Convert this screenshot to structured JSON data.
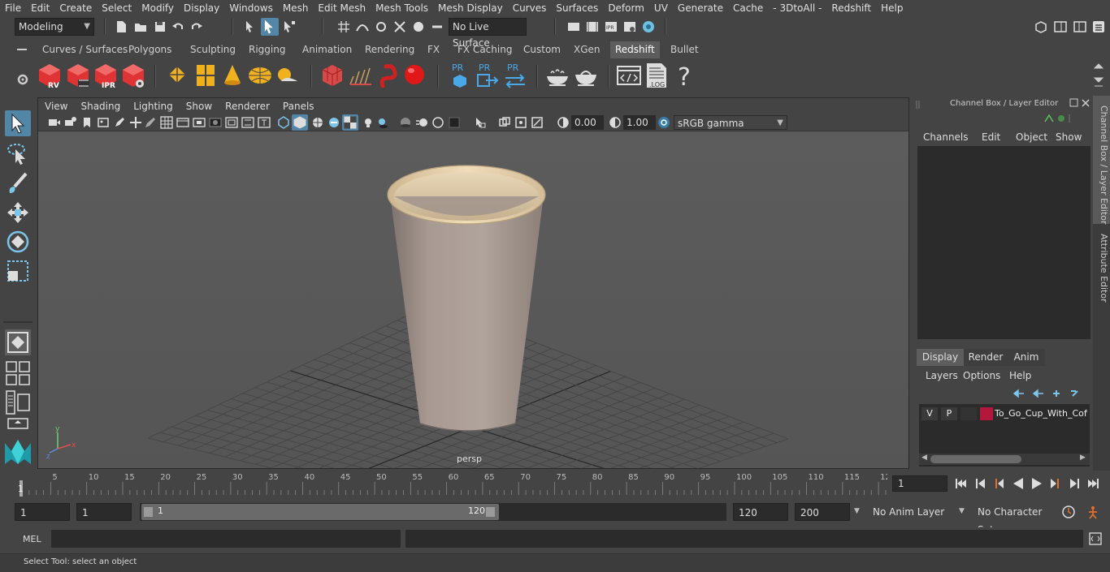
{
  "menubar": {
    "items": [
      "File",
      "Edit",
      "Create",
      "Select",
      "Modify",
      "Display",
      "Windows",
      "Mesh",
      "Edit Mesh",
      "Mesh Tools",
      "Mesh Display",
      "Curves",
      "Surfaces",
      "Deform",
      "UV",
      "Generate",
      "Cache",
      "- 3DtoAll -",
      "Redshift",
      "Help"
    ]
  },
  "statusline": {
    "mode": "Modeling",
    "live_surface": "No Live Surface"
  },
  "shelf": {
    "tabs": [
      "Curves / Surfaces",
      "Polygons",
      "Sculpting",
      "Rigging",
      "Animation",
      "Rendering",
      "FX",
      "FX Caching",
      "Custom",
      "XGen",
      "Redshift",
      "Bullet"
    ],
    "active_tab": "Redshift",
    "icon_labels": {
      "rv": "RV",
      "ipr": "IPR",
      "pr1": "PR",
      "pr2": "PR",
      "pr3": "PR",
      "log": ".LOG",
      "help": "?"
    }
  },
  "viewport": {
    "menu": [
      "View",
      "Shading",
      "Lighting",
      "Show",
      "Renderer",
      "Panels"
    ],
    "exposure": "0.00",
    "gamma": "1.00",
    "color_space": "sRGB gamma",
    "camera_label": "persp",
    "axis_x": "x",
    "axis_y": "y",
    "axis_z": "z"
  },
  "right_panel": {
    "title": "Channel Box / Layer Editor",
    "channel_menu": [
      "Channels",
      "Edit",
      "Object",
      "Show"
    ],
    "layer_tabs": [
      "Display",
      "Render",
      "Anim"
    ],
    "layer_menu": [
      "Layers",
      "Options",
      "Help"
    ],
    "layer": {
      "v": "V",
      "p": "P",
      "name": "To_Go_Cup_With_Coff",
      "color": "#b3173a"
    }
  },
  "side_tabs": [
    "Channel Box / Layer Editor",
    "Attribute Editor"
  ],
  "timeline": {
    "ticks": [
      "5",
      "10",
      "15",
      "20",
      "25",
      "30",
      "35",
      "40",
      "45",
      "50",
      "55",
      "60",
      "65",
      "70",
      "75",
      "80",
      "85",
      "90",
      "95",
      "100",
      "105",
      "110",
      "115",
      "12"
    ],
    "start_marker": "1",
    "current_frame": "1"
  },
  "range": {
    "start": "1",
    "playback_start": "1",
    "slider_start": "1",
    "slider_end": "120",
    "playback_end": "120",
    "end": "200",
    "anim_layer": "No Anim Layer",
    "character_set": "No Character Set"
  },
  "cmdline": {
    "lang": "MEL"
  },
  "helpline": {
    "text": "Select Tool: select an object"
  },
  "colors": {
    "accent": "#5285a6",
    "redshift_red": "#e03434",
    "cup": "#a89a92",
    "cup_rim": "#e2cda9"
  }
}
